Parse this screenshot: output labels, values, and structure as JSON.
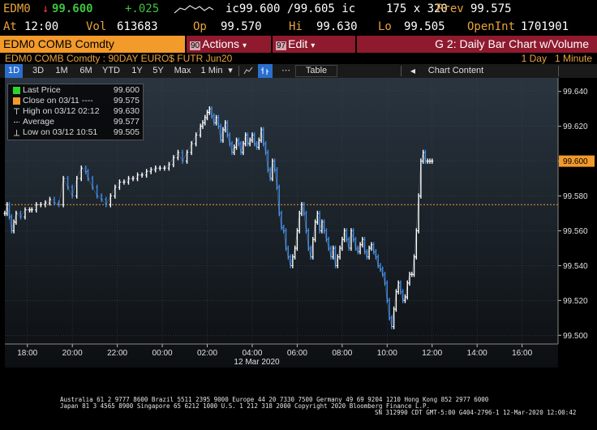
{
  "quote": {
    "ticker": "EDM0",
    "last": "99.600",
    "arrow": "↓",
    "change": "+.025",
    "bid_ask": "ic99.600 /99.605 ic",
    "size": "175 x 320",
    "prev_label": "Prev",
    "prev": "99.575",
    "at_label": "At",
    "at_time": "12:00",
    "vol_label": "Vol",
    "vol": "613683",
    "op_label": "Op",
    "op": "99.570",
    "hi_label": "Hi",
    "hi": "99.630",
    "lo_label": "Lo",
    "lo": "99.505",
    "openint_label": "OpenInt",
    "openint": "1701901"
  },
  "function_bar": {
    "security": "EDM0 COMB Comdty",
    "menu1_num": "90",
    "menu1_label": "Actions",
    "menu2_num": "97",
    "menu2_label": "Edit",
    "title": "G 2: Daily Bar Chart w/Volume"
  },
  "subtitle": {
    "description": "EDM0 COMB Comdty : 90DAY EURO$ FUTR  Jun20",
    "period": "1 Day",
    "interval": "1 Minute"
  },
  "toolbar": {
    "ranges": [
      "1D",
      "3D",
      "1M",
      "6M",
      "YTD",
      "1Y",
      "5Y",
      "Max"
    ],
    "active_range": "1D",
    "interval": "1 Min",
    "interval_arrow": "▾",
    "table": "Table",
    "chart_content": "Chart Content"
  },
  "legend": {
    "items": [
      {
        "name": "Last Price",
        "value": "99.600",
        "color": "#2bd62b"
      },
      {
        "name": "Close on 03/11  ----",
        "value": "99.575",
        "color": "#f29a2a"
      },
      {
        "name": "High on 03/12 02:12",
        "value": "99.630",
        "color": "#bbbbbb"
      },
      {
        "name": "Average",
        "value": "99.577",
        "color": "#bbbbbb"
      },
      {
        "name": "Low on 03/12 10:51",
        "value": "99.505",
        "color": "#bbbbbb"
      }
    ]
  },
  "chart_data": {
    "type": "line",
    "title": "",
    "xlabel": "12 Mar 2020",
    "ylabel": "",
    "ylim": [
      99.495,
      99.645
    ],
    "y_ticks": [
      "99.640",
      "99.620",
      "99.600",
      "99.580",
      "99.560",
      "99.540",
      "99.520",
      "99.500"
    ],
    "x_ticks": [
      "18:00",
      "20:00",
      "22:00",
      "00:00",
      "02:00",
      "04:00",
      "06:00",
      "08:00",
      "10:00",
      "12:00",
      "14:00",
      "16:00"
    ],
    "last_price_label": "99.600",
    "reference_line": 99.575,
    "series": [
      {
        "name": "Last Price",
        "x_hours": [
          -7.0,
          -6.9,
          -6.8,
          -6.7,
          -6.6,
          -6.5,
          -6.3,
          -6.1,
          -5.9,
          -5.8,
          -5.6,
          -5.4,
          -5.2,
          -5.0,
          -4.8,
          -4.6,
          -4.4,
          -4.2,
          -4.0,
          -3.8,
          -3.6,
          -3.4,
          -3.3,
          -3.1,
          -2.9,
          -2.7,
          -2.5,
          -2.3,
          -2.1,
          -1.9,
          -1.7,
          -1.5,
          -1.3,
          -1.1,
          -0.9,
          -0.7,
          -0.5,
          -0.3,
          -0.1,
          0.1,
          0.3,
          0.5,
          0.7,
          0.9,
          1.1,
          1.3,
          1.5,
          1.7,
          1.8,
          1.9,
          2.0,
          2.1,
          2.2,
          2.3,
          2.4,
          2.5,
          2.6,
          2.7,
          2.8,
          2.9,
          3.0,
          3.1,
          3.2,
          3.3,
          3.4,
          3.5,
          3.6,
          3.7,
          3.8,
          3.9,
          4.0,
          4.1,
          4.2,
          4.3,
          4.4,
          4.5,
          4.6,
          4.7,
          4.8,
          4.9,
          5.0,
          5.1,
          5.2,
          5.3,
          5.4,
          5.5,
          5.6,
          5.7,
          5.8,
          5.9,
          6.0,
          6.1,
          6.2,
          6.3,
          6.4,
          6.5,
          6.6,
          6.7,
          6.8,
          6.9,
          7.0,
          7.1,
          7.2,
          7.3,
          7.4,
          7.5,
          7.6,
          7.7,
          7.8,
          7.9,
          8.0,
          8.1,
          8.2,
          8.3,
          8.4,
          8.5,
          8.6,
          8.7,
          8.8,
          8.9,
          9.0,
          9.1,
          9.2,
          9.3,
          9.4,
          9.5,
          9.6,
          9.7,
          9.8,
          9.9,
          10.0,
          10.1,
          10.2,
          10.3,
          10.4,
          10.5,
          10.6,
          10.7,
          10.8,
          10.9,
          11.0,
          11.1,
          11.2,
          11.3,
          11.4,
          11.5,
          11.6,
          11.7,
          11.8,
          11.9,
          12.0
        ],
        "values": [
          99.57,
          99.575,
          99.568,
          99.56,
          99.565,
          99.57,
          99.568,
          99.572,
          99.572,
          99.572,
          99.575,
          99.575,
          99.576,
          99.578,
          99.576,
          99.575,
          99.59,
          99.585,
          99.58,
          99.59,
          99.596,
          99.594,
          99.59,
          99.585,
          99.58,
          99.578,
          99.575,
          99.58,
          99.585,
          99.588,
          99.588,
          99.59,
          99.59,
          99.592,
          99.592,
          99.594,
          99.595,
          99.596,
          99.596,
          99.596,
          99.598,
          99.602,
          99.605,
          99.6,
          99.605,
          99.61,
          99.615,
          99.62,
          99.622,
          99.625,
          99.628,
          99.63,
          99.626,
          99.622,
          99.625,
          99.62,
          99.612,
          99.618,
          99.622,
          99.615,
          99.61,
          99.605,
          99.608,
          99.612,
          99.61,
          99.605,
          99.61,
          99.615,
          99.61,
          99.612,
          99.615,
          99.61,
          99.608,
          99.612,
          99.618,
          99.61,
          99.605,
          99.595,
          99.59,
          99.6,
          99.595,
          99.585,
          99.57,
          99.562,
          99.56,
          99.55,
          99.545,
          99.54,
          99.545,
          99.55,
          99.56,
          99.57,
          99.575,
          99.57,
          99.56,
          99.55,
          99.545,
          99.555,
          99.565,
          99.57,
          99.56,
          99.565,
          99.56,
          99.555,
          99.55,
          99.545,
          99.55,
          99.54,
          99.545,
          99.55,
          99.555,
          99.56,
          99.555,
          99.55,
          99.56,
          99.555,
          99.55,
          99.548,
          99.552,
          99.555,
          99.548,
          99.545,
          99.55,
          99.552,
          99.548,
          99.545,
          99.54,
          99.538,
          99.535,
          99.53,
          99.52,
          99.51,
          99.505,
          99.515,
          99.525,
          99.53,
          99.525,
          99.52,
          99.522,
          99.53,
          99.535,
          99.535,
          99.545,
          99.56,
          99.58,
          99.6,
          99.605,
          99.6,
          99.6,
          99.6,
          99.6
        ]
      }
    ]
  },
  "footer": {
    "line1": "Australia 61 2 9777 8600 Brazil 5511 2395 9000 Europe 44 20 7330 7500 Germany 49 69 9204 1210 Hong Kong 852 2977 6000",
    "line2": "Japan 81 3 4565 8900        Singapore 65 6212 1000      U.S. 1 212 318 2000         Copyright 2020 Bloomberg Finance L.P.",
    "line3": "SN 312990 CDT  GMT-5:00 G404-2796-1 12-Mar-2020 12:00:42"
  },
  "colors": {
    "bloomberg_orange": "#f29a2a",
    "menu_red": "#8f1a2e",
    "bar_white": "#ffffff",
    "bar_blue": "#3c8ae6",
    "last_label_bg": "#f29a2a",
    "reference_line": "#f29a2a"
  }
}
